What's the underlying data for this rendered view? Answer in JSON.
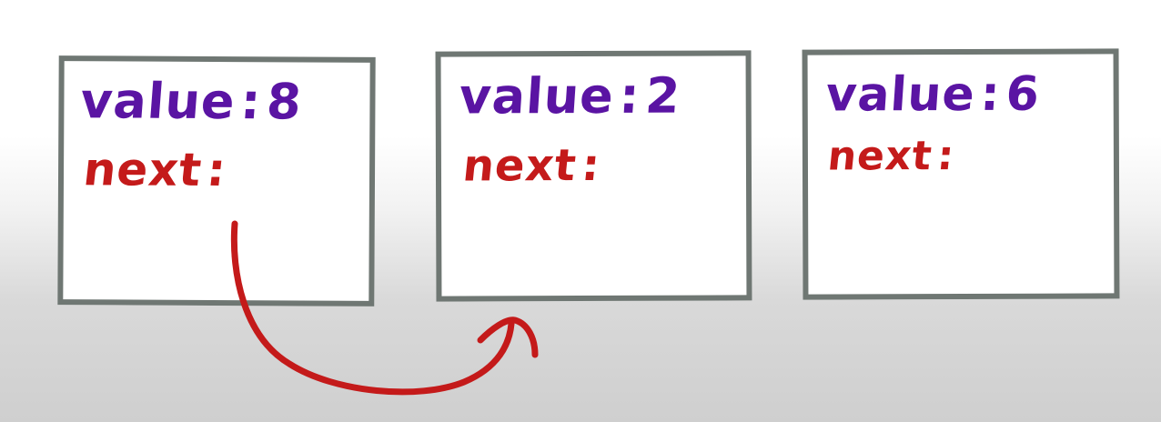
{
  "colors": {
    "box_border": "#6f7773",
    "value_text": "#5a14a3",
    "next_text": "#c41a1a",
    "arrow": "#c41a1a"
  },
  "nodes": [
    {
      "value_label": "value",
      "value": "8",
      "next_label": "next"
    },
    {
      "value_label": "value",
      "value": "2",
      "next_label": "next"
    },
    {
      "value_label": "value",
      "value": "6",
      "next_label": "next"
    }
  ],
  "links": [
    {
      "from": 0,
      "to": 1
    }
  ]
}
